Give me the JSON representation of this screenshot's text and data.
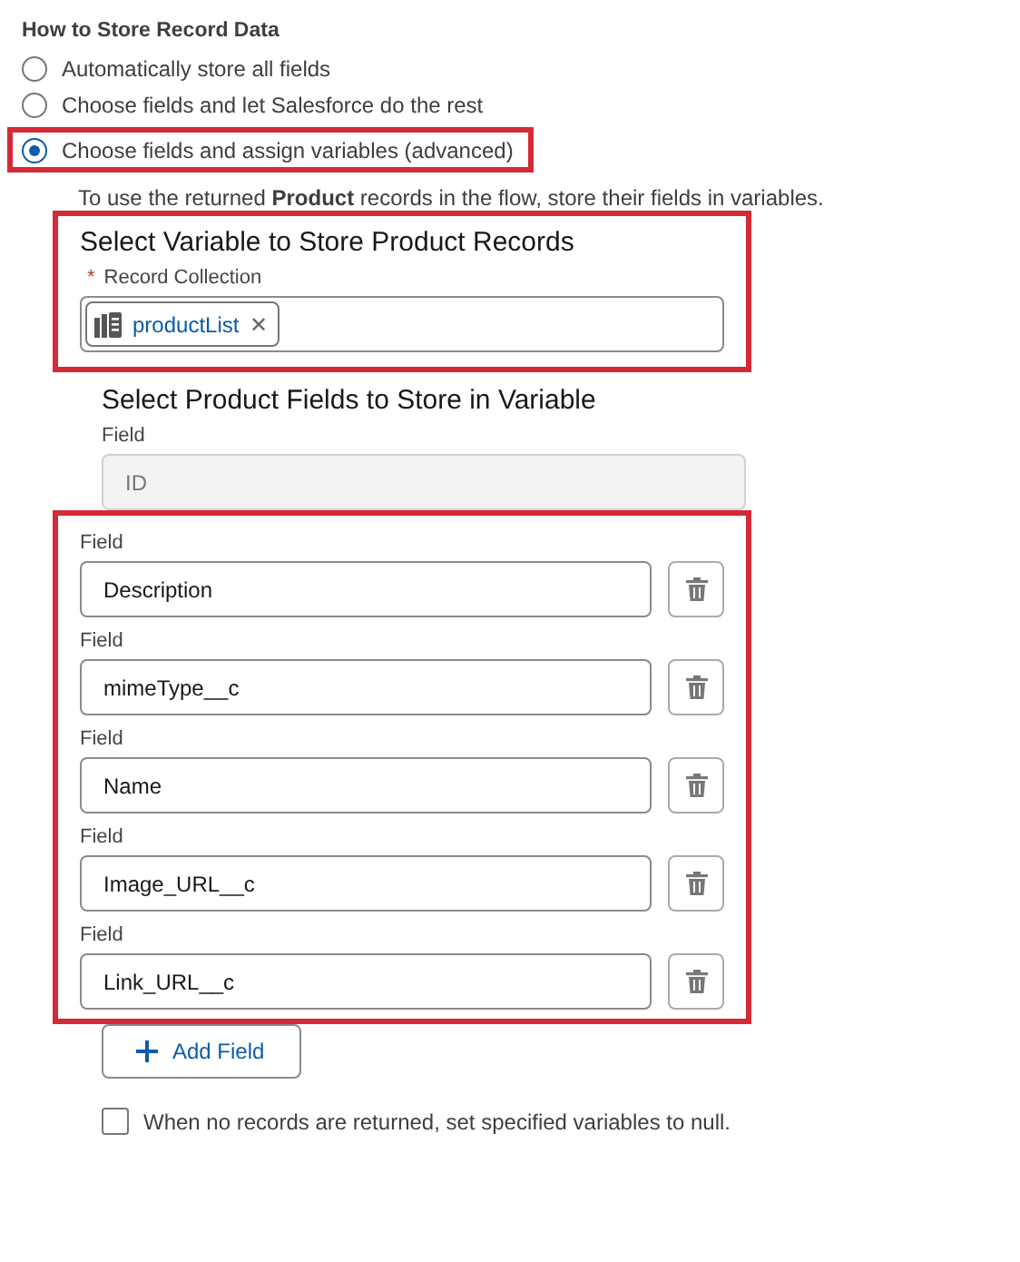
{
  "heading": "How to Store Record Data",
  "options": [
    {
      "label": "Automatically store all fields",
      "selected": false,
      "highlighted": false
    },
    {
      "label": "Choose fields and let Salesforce do the rest",
      "selected": false,
      "highlighted": false
    },
    {
      "label": "Choose fields and assign variables (advanced)",
      "selected": true,
      "highlighted": true
    }
  ],
  "description": "To use the returned **Product** records in the flow, store their fields in variables.",
  "variable_section": {
    "title": "Select Variable to Store Product Records",
    "highlighted": true,
    "field": {
      "label": "Record Collection",
      "required_mark": "*",
      "pill": "productList",
      "pill_remove": "✕"
    }
  },
  "fields_section": {
    "title": "Select Product Fields to Store in Variable",
    "fixed_field": {
      "label": "Field",
      "value": "ID",
      "disabled": true
    },
    "highlighted": true,
    "fields": [
      {
        "label": "Field",
        "value": "Description"
      },
      {
        "label": "Field",
        "value": "mimeType__c"
      },
      {
        "label": "Field",
        "value": "Name"
      },
      {
        "label": "Field",
        "value": "Image_URL__c"
      },
      {
        "label": "Field",
        "value": "Link_URL__c"
      }
    ],
    "add_button": "Add Field"
  },
  "null_option": {
    "label": "When no records are returned, set specified variables to null.",
    "checked": false
  }
}
